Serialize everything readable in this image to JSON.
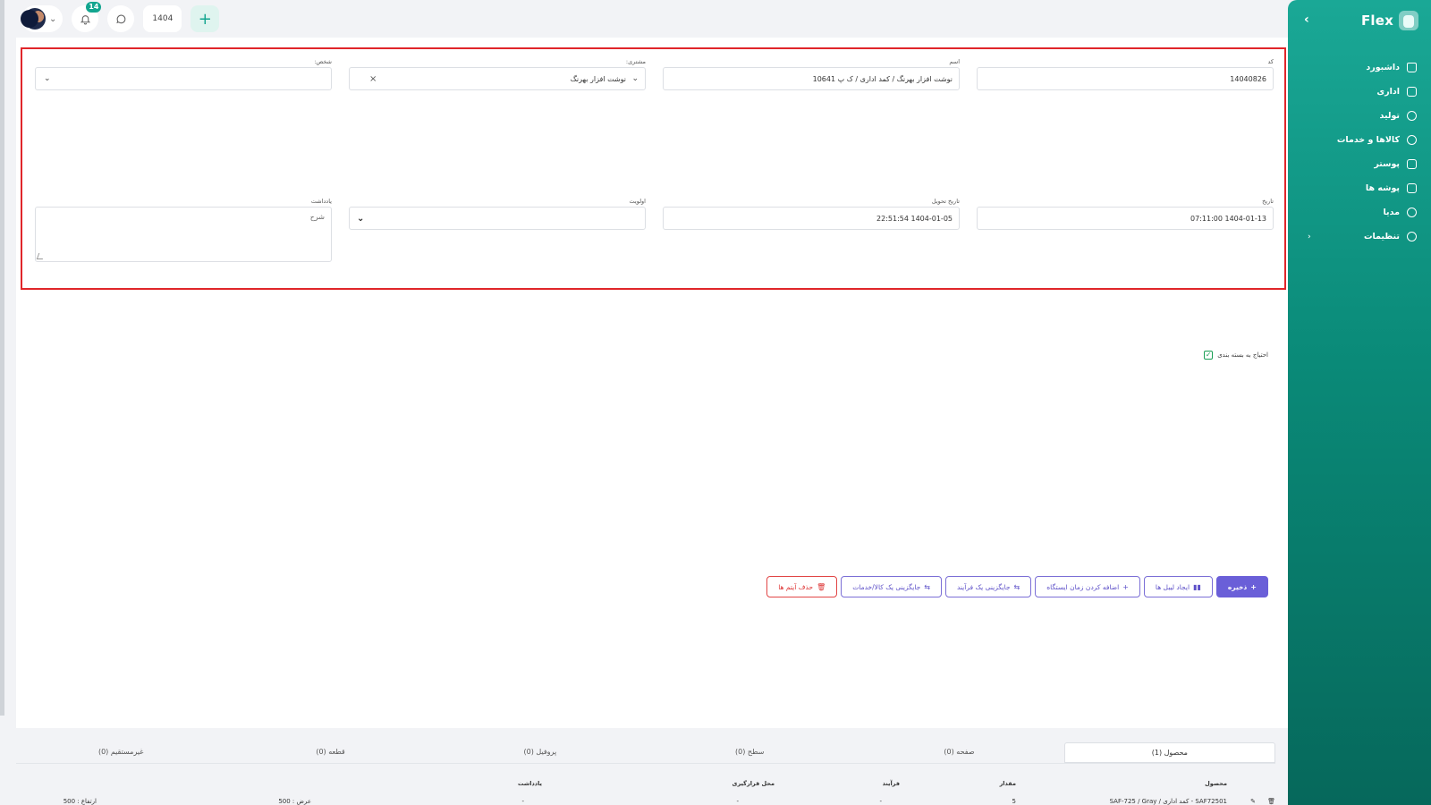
{
  "topbar": {
    "notifications_count": "14",
    "year": "1404",
    "add_label": "+"
  },
  "sidebar": {
    "logo_text": "Flex",
    "collapse_icon": "chevron-left-icon",
    "items": [
      {
        "label": "داشبورد",
        "icon": "home-icon"
      },
      {
        "label": "اداری",
        "icon": "briefcase-icon"
      },
      {
        "label": "تولید",
        "icon": "factory-icon"
      },
      {
        "label": "کالاها و خدمات",
        "icon": "box-icon"
      },
      {
        "label": "پوستر",
        "icon": "image-icon"
      },
      {
        "label": "پوشه ها",
        "icon": "folder-icon"
      },
      {
        "label": "مدیا",
        "icon": "media-icon"
      },
      {
        "label": "تنظیمات",
        "icon": "gear-icon",
        "has_submenu": true
      }
    ]
  },
  "form": {
    "code": {
      "label": "کد",
      "value": "14040826"
    },
    "name": {
      "label": "اسم",
      "value": "نوشت افزار بهرنگ / کمد اداری / ک پ 10641"
    },
    "customer": {
      "label": "مشتری:",
      "value": "نوشت افزار بهرنگ"
    },
    "person": {
      "label": "شخص:",
      "value": ""
    },
    "date": {
      "label": "تاریخ",
      "value": "1404-01-13 07:11:00"
    },
    "delivery_date": {
      "label": "تاریخ تحویل",
      "value": "1404-01-05 22:51:54"
    },
    "priority": {
      "label": "اولویت",
      "value": ""
    },
    "note": {
      "label": "یادداشت",
      "placeholder": "شرح"
    }
  },
  "packaging_checkbox": {
    "label": "احتیاج به بسته بندی",
    "checked": true
  },
  "actions": {
    "save": "ذخیره",
    "create_labels": "ایجاد لیبل ها",
    "add_station_time": "اضافه کردن زمان ایستگاه",
    "replace_process": "جایگزینی یک فرآیند",
    "replace_product": "جایگزینی یک کالا/خدمات",
    "delete_items": "حذف آیتم ها"
  },
  "tabs": [
    {
      "label": "محصول (1)",
      "active": true
    },
    {
      "label": "صفحه (0)"
    },
    {
      "label": "سطح (0)"
    },
    {
      "label": "پروفیل (0)"
    },
    {
      "label": "قطعه (0)"
    },
    {
      "label": "غیرمستقیم (0)"
    }
  ],
  "table": {
    "headers": [
      "محصول",
      "مقدار",
      "فرآیند",
      "محل قرارگیری",
      "یادداشت"
    ],
    "row": {
      "product": "SAF72501 - کمد اداری / SAF-725 / Gray",
      "qty": "5",
      "process": "-",
      "location": "-",
      "note": "-",
      "width": "عرض : 500",
      "height": "ارتفاع : 500"
    }
  }
}
